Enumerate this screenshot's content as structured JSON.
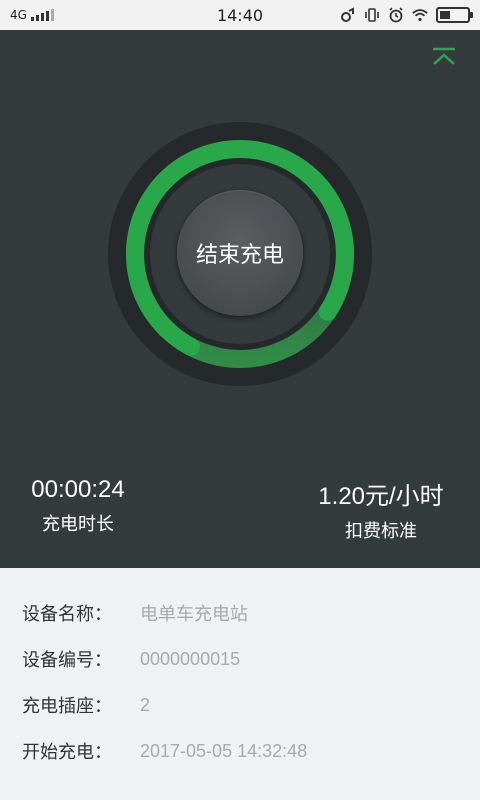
{
  "status_bar": {
    "network": "4G",
    "time": "14:40"
  },
  "colors": {
    "accent": "#29a84a",
    "panel_bg": "#353a3d",
    "info_bg": "#eef2f5"
  },
  "charging": {
    "progress": 0.9,
    "stop_label": "结束充电",
    "duration_value": "00:00:24",
    "duration_label": "充电时长",
    "rate_value": "1.20元/小时",
    "rate_label": "扣费标准"
  },
  "device_info": [
    {
      "key": "设备名称：",
      "value": "电单车充电站"
    },
    {
      "key": "设备编号：",
      "value": "0000000015"
    },
    {
      "key": "充电插座：",
      "value": "2"
    },
    {
      "key": "开始充电：",
      "value": "2017-05-05 14:32:48"
    }
  ]
}
